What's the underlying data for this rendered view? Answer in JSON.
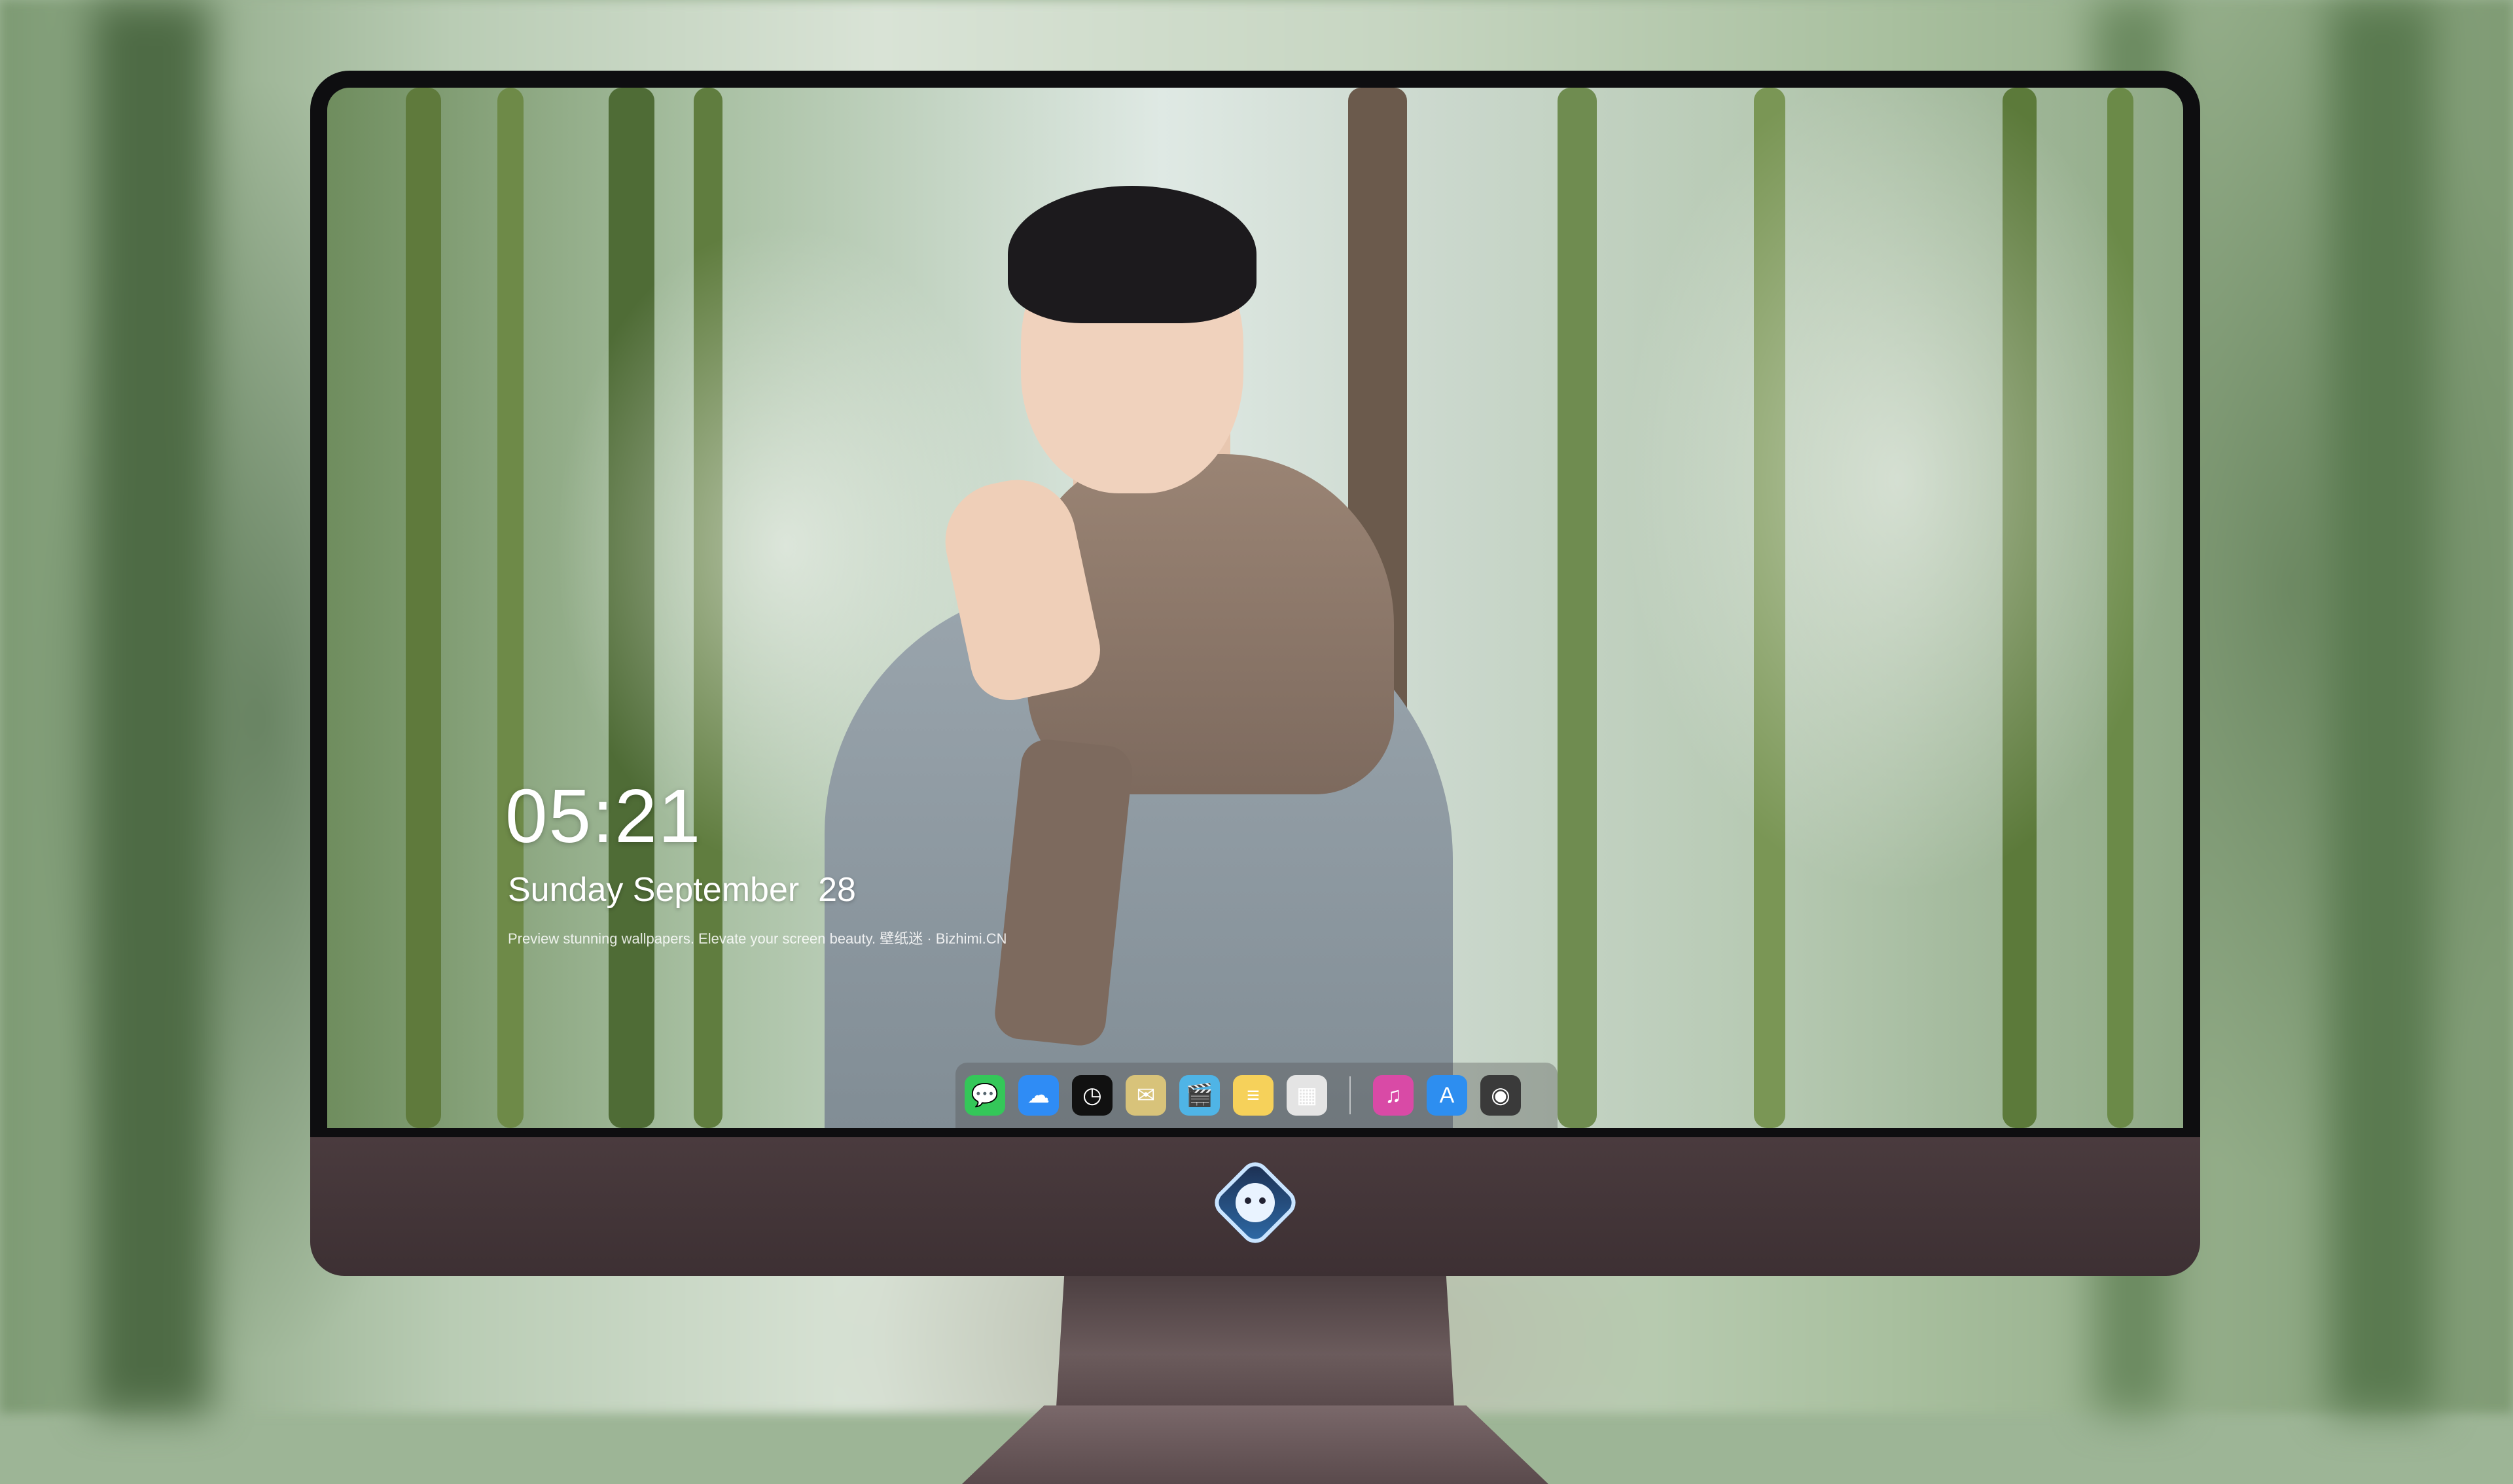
{
  "lock_screen": {
    "time": "05:21",
    "date": "Sunday September  28",
    "tagline": "Preview stunning wallpapers. Elevate your screen beauty. 壁纸迷 · Bizhimi.CN"
  },
  "dock": {
    "apps": [
      {
        "name": "messages-icon",
        "glyph": "💬",
        "color": "#34c759"
      },
      {
        "name": "weather-icon",
        "glyph": "☁",
        "color": "#2f8cf5"
      },
      {
        "name": "clock-icon",
        "glyph": "◷",
        "color": "#111111"
      },
      {
        "name": "preview-icon",
        "glyph": "✉",
        "color": "#d8c37a"
      },
      {
        "name": "clapperboard-icon",
        "glyph": "🎬",
        "color": "#4fb4e6"
      },
      {
        "name": "notes-icon",
        "glyph": "≡",
        "color": "#f6d15a"
      },
      {
        "name": "photo-booth-icon",
        "glyph": "▦",
        "color": "#e4e4e4"
      },
      {
        "name": "music-icon",
        "glyph": "♫",
        "color": "#d94aa6"
      },
      {
        "name": "app-store-icon",
        "glyph": "A",
        "color": "#2d8ef0"
      },
      {
        "name": "camera-icon",
        "glyph": "◉",
        "color": "#3a3a3a"
      }
    ]
  },
  "colors": {
    "monitor_bezel": "#0e0e10",
    "monitor_chin": "#4a3b3e",
    "text": "#ffffff"
  }
}
